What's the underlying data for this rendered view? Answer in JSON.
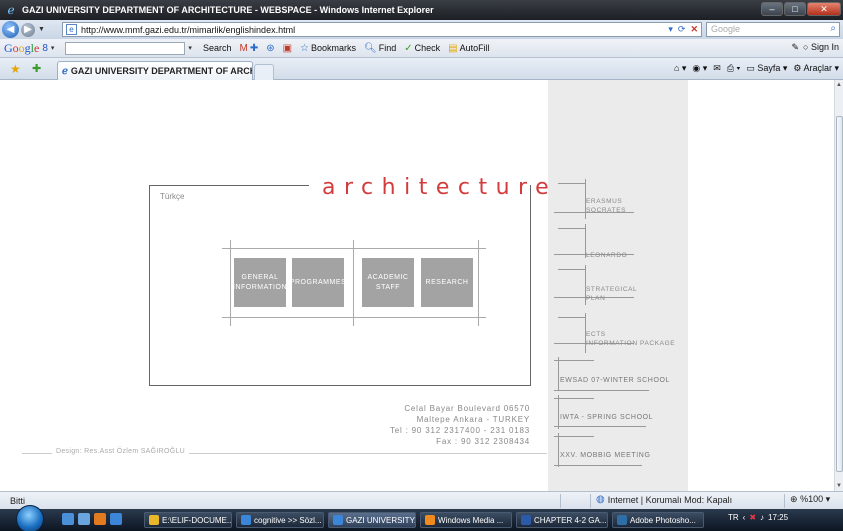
{
  "window": {
    "title": "GAZI UNIVERSITY DEPARTMENT OF ARCHITECTURE - WEBSPACE - Windows Internet Explorer"
  },
  "addressbar": {
    "url": "http://www.mmf.gazi.edu.tr/mimarlik/englishindex.html",
    "search_placeholder": "Google"
  },
  "google_toolbar": {
    "logo": "Google",
    "count": "8",
    "search_label": "Search",
    "bookmarks_label": "Bookmarks",
    "find_label": "Find",
    "check_label": "Check",
    "autofill_label": "AutoFill",
    "signin_label": "Sign In"
  },
  "tabs": [
    {
      "label": "GAZI UNIVERSITY DEPARTMENT OF ARCHITECT..."
    }
  ],
  "command_bar": {
    "page_label": "Sayfa",
    "tools_label": "Araçlar"
  },
  "page": {
    "title": "architecture",
    "language_link": "Türkçe",
    "menu": [
      {
        "label": "GENERAL INFORMATION"
      },
      {
        "label": "PROGRAMMES"
      },
      {
        "label": "ACADEMIC STAFF"
      },
      {
        "label": "RESEARCH"
      }
    ],
    "address_lines": [
      "Celal Bayar Boulevard 06570",
      "Maltepe Ankara - TURKEY",
      "Tel : 90 312 2317400 - 231 0183",
      "Fax : 90 312 2308434"
    ],
    "designer": "Design: Res.Asst Özlem SAĞIROĞLU",
    "side_links": [
      {
        "label": "ERASMUS\nSOCRATES"
      },
      {
        "label": "LEONARDO"
      },
      {
        "label": "STRATEGICAL\nPLAN"
      },
      {
        "label": "ECTS\nINFORMATION PACKAGE"
      },
      {
        "label": "EWSAD 07-WINTER SCHOOL"
      },
      {
        "label": "IWTA - SPRING SCHOOL"
      },
      {
        "label": "XXV. MOBBIG MEETING"
      }
    ]
  },
  "statusbar": {
    "status": "Bitti",
    "zone": "Internet | Korumalı Mod: Kapalı",
    "zoom": "%100"
  },
  "taskbar": {
    "items": [
      {
        "label": "E:\\ELIF-DOCUME...",
        "color": "#e8b82a"
      },
      {
        "label": "cognitive >> Sözl...",
        "color": "#3b86d8"
      },
      {
        "label": "GAZI UNIVERSITY...",
        "color": "#3b86d8"
      },
      {
        "label": "Windows Media ...",
        "color": "#f08a1c"
      },
      {
        "label": "CHAPTER 4-2 GA...",
        "color": "#2b5aa8"
      },
      {
        "label": "Adobe Photosho...",
        "color": "#2f6fa8"
      }
    ],
    "language": "TR",
    "clock": "17:25"
  },
  "colors": {
    "accent_red": "#d23c3c",
    "menu_grey": "#a3a3a3",
    "side_panel": "#ebebeb"
  }
}
